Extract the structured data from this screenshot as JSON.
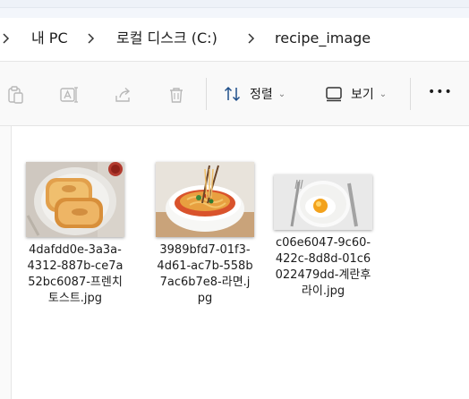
{
  "breadcrumb": {
    "items": [
      "내 PC",
      "로컬 디스크 (C:)",
      "recipe_image"
    ]
  },
  "toolbar": {
    "sort_label": "정렬",
    "view_label": "보기",
    "more_label": "•••"
  },
  "files": [
    {
      "name": "4dafdd0e-3a3a-4312-887b-ce7a52bc6087-프렌치토스트.jpg",
      "thumb": "french-toast"
    },
    {
      "name": "3989bfd7-01f3-4d61-ac7b-558b7ac6b7e8-라면.jpg",
      "thumb": "ramen"
    },
    {
      "name": "c06e6047-9c60-422c-8d8d-01c6022479dd-계란후라이.jpg",
      "thumb": "fried-egg"
    }
  ]
}
